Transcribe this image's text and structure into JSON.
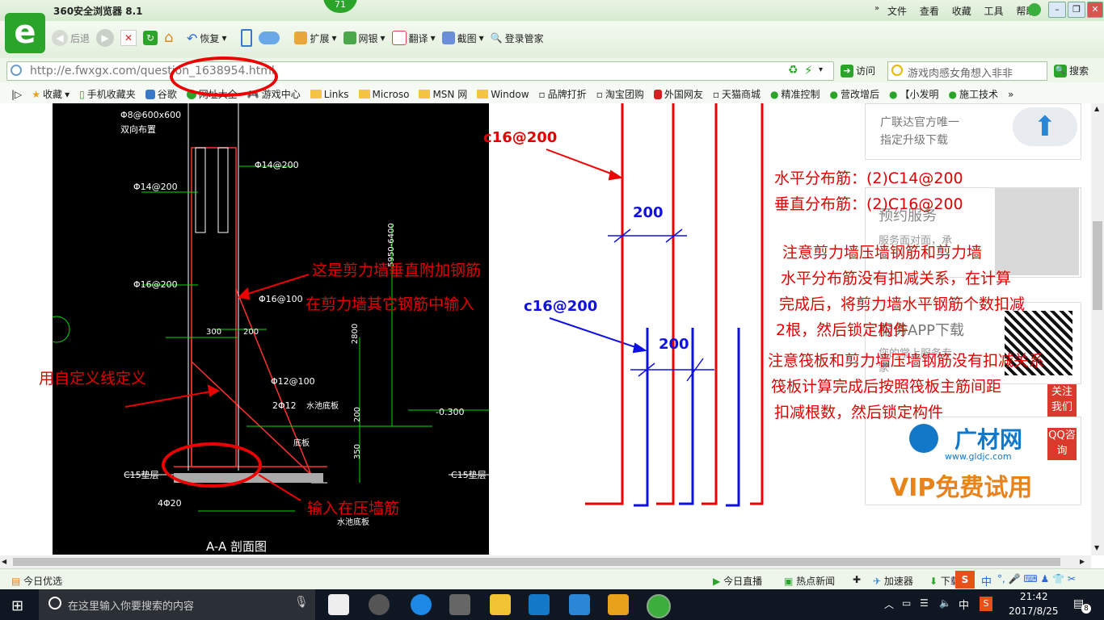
{
  "browser": {
    "title": "360安全浏览器 8.1",
    "badge": "71",
    "menu": [
      "文件",
      "查看",
      "收藏",
      "工具",
      "帮助"
    ],
    "toolbar": {
      "back": "后退",
      "restore": "恢复",
      "extend": "扩展",
      "bank": "网银",
      "translate": "翻译",
      "screenshot": "截图",
      "login": "登录管家"
    },
    "url": "http://e.fwxgx.com/question_1638954.html",
    "visit": "访问",
    "search_placeholder": "游戏肉感女角想入非非",
    "search_button": "搜索"
  },
  "favorites": [
    "收藏",
    "手机收藏夹",
    "谷歌",
    "网址大全",
    "游戏中心",
    "Links",
    "Microso",
    "MSN 网",
    "Window",
    "品牌打折",
    "淘宝团购",
    "外国网友",
    "天猫商城",
    "精准控制",
    "营改增后",
    "【小发明",
    "施工技术"
  ],
  "cad": {
    "labels": [
      "Φ8@600x600",
      "双向布置",
      "Φ14@200",
      "Φ14@200",
      "Φ16@200",
      "Φ16@100",
      "300",
      "200",
      "2800",
      "5950-6400",
      "Φ12@100",
      "2Φ12",
      "水池底板",
      "200",
      "350",
      "-0.300",
      "底板",
      "C15垫层",
      "C15垫层",
      "4Φ20",
      "水池底板",
      "A-A 剖面图"
    ],
    "annotations": {
      "vertical_extra": "这是剪力墙垂直附加钢筋",
      "input_other": "在剪力墙其它钢筋中输入",
      "custom_line": "用自定义线定义",
      "press_wall": "输入在压墙筋"
    }
  },
  "right_diagram": {
    "labels": {
      "c16_top": "c16@200",
      "c16_mid": "c16@200",
      "dim_top": "200",
      "dim_mid": "200"
    },
    "notes": [
      "水平分布筋：(2)C14@200",
      "垂直分布筋：(2)C16@200",
      "注意剪力墙压墙钢筋和剪力墙",
      "水平分布筋没有扣减关系，在计算",
      "完成后，将剪力墙水平钢筋个数扣减",
      "2根，然后锁定构件",
      "注意筏板和剪力墙压墙钢筋没有扣减关系",
      "筏板计算完成后按照筏板主筋间距",
      "扣减根数，然后锁定构件"
    ]
  },
  "sidebar": {
    "ad1_line1": "广联达官方唯一",
    "ad1_line2": "指定升级下载",
    "ad2_title": "预约服务",
    "ad2_line": "服务面对面，承",
    "ad3_title": "服务APP下载",
    "ad3_line1": "您的掌上服务专",
    "ad3_line2": "家",
    "follow": "关注我们",
    "qq": "QQ咨询",
    "brand": "广材网",
    "brand_url": "www.gldjc.com",
    "vip": "VIP免费试用"
  },
  "status": {
    "left": "今日优选",
    "items": [
      "今日直播",
      "热点新闻",
      "加速器",
      "下载"
    ],
    "ime": "中"
  },
  "taskbar": {
    "search_placeholder": "在这里输入你要搜索的内容",
    "time": "21:42",
    "date": "2017/8/25",
    "ime": "中",
    "notify": "8"
  }
}
